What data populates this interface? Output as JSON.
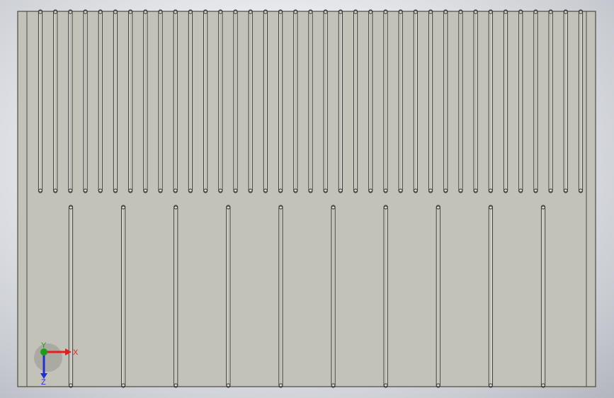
{
  "colors": {
    "background_center": "#f7f8fa",
    "background_edge": "#b3b6bd",
    "plate_face": "#c2c2b8",
    "plate_edge": "#4a4a46",
    "slot_fill": "#d9d9d0",
    "slot_edge": "#3c3c3a",
    "axis_x": "#e02020",
    "axis_y": "#18a018",
    "axis_z": "#2030d0"
  },
  "triad": {
    "x_label": "X",
    "y_label": "Y",
    "z_label": "Z"
  },
  "model": {
    "upper_slot_row_count": 37,
    "lower_slot_row_count": 10
  }
}
